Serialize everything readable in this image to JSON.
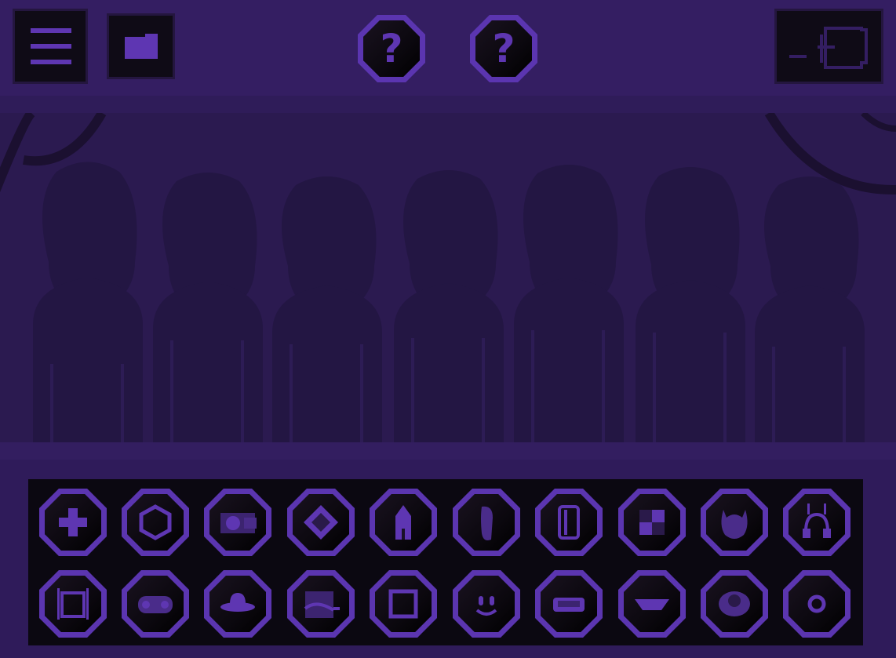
{
  "top_bar": {
    "menu_icon": "hamburger-menu-icon",
    "folder_icon": "folder-icon",
    "help_buttons": [
      {
        "label": "?",
        "icon": "question-icon"
      },
      {
        "label": "?",
        "icon": "question-icon"
      }
    ],
    "power_icon": "power-plug-icon"
  },
  "stage": {
    "character_slots": 7
  },
  "palette": {
    "accent": "#5b35b0",
    "background": "#2c1a52",
    "panel": "#0b0811"
  },
  "sound_icons": {
    "row1": [
      "plus-icon",
      "hexagon-icon",
      "camera-icon",
      "diamond-sticker-icon",
      "rocket-icon",
      "bean-icon",
      "cylinder-icon",
      "checker-icon",
      "horned-helmet-icon",
      "antenna-headphones-icon"
    ],
    "row2": [
      "backpack-frame-icon",
      "gamepad-icon",
      "hat-icon",
      "pipe-screen-icon",
      "square-frame-icon",
      "smiley-face-icon",
      "visor-icon",
      "mustache-icon",
      "eye-icon",
      "ring-icon"
    ]
  }
}
